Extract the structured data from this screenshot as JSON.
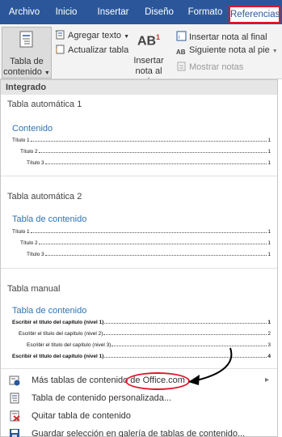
{
  "tabs": [
    {
      "label": "Archivo"
    },
    {
      "label": "Inicio"
    },
    {
      "label": "Insertar"
    },
    {
      "label": "Diseño"
    },
    {
      "label": "Formato"
    },
    {
      "label": "Referencias"
    }
  ],
  "ribbon": {
    "toc_line1": "Tabla de",
    "toc_line2": "contenido",
    "add_text": "Agregar texto",
    "update_table": "Actualizar tabla",
    "footnote_icon": "AB",
    "footnote_sup": "1",
    "insert_footnote_line1": "Insertar",
    "insert_footnote_line2": "nota al pie",
    "insert_endnote": "Insertar nota al final",
    "next_footnote": "Siguiente nota al pie",
    "show_notes": "Mostrar notas"
  },
  "gallery": {
    "header": "Integrado",
    "auto1": {
      "title": "Tabla automática 1",
      "heading": "Contenido",
      "lines": [
        {
          "text": "Título 1",
          "page": "1"
        },
        {
          "text": "Título 2",
          "page": "1"
        },
        {
          "text": "Título 3",
          "page": "1"
        }
      ]
    },
    "auto2": {
      "title": "Tabla automática 2",
      "heading": "Tabla de contenido",
      "lines": [
        {
          "text": "Título 1",
          "page": "1"
        },
        {
          "text": "Título 2",
          "page": "1"
        },
        {
          "text": "Título 3",
          "page": "1"
        }
      ]
    },
    "manual": {
      "title": "Tabla manual",
      "heading": "Tabla de contenido",
      "lines": [
        {
          "text": "Escribir el título del capítulo (nivel 1)",
          "page": "1"
        },
        {
          "text": "Escribir el título del capítulo (nivel 2)",
          "page": "2"
        },
        {
          "text": "Escribir el título del capítulo (nivel 3)",
          "page": "3"
        },
        {
          "text": "Escribir el título del capítulo (nivel 1)",
          "page": "4"
        }
      ]
    }
  },
  "menu": {
    "more_tables_prefix": "Más tablas de contenido de ",
    "more_tables_site": "Office.com",
    "custom": "Tabla de contenido personalizada...",
    "remove": "Quitar tabla de contenido",
    "save": "Guardar selección en galería de tablas de contenido..."
  },
  "colors": {
    "ribbon_blue": "#2b579a",
    "toc_heading": "#2e74b5",
    "highlight_red": "#e0152a"
  }
}
